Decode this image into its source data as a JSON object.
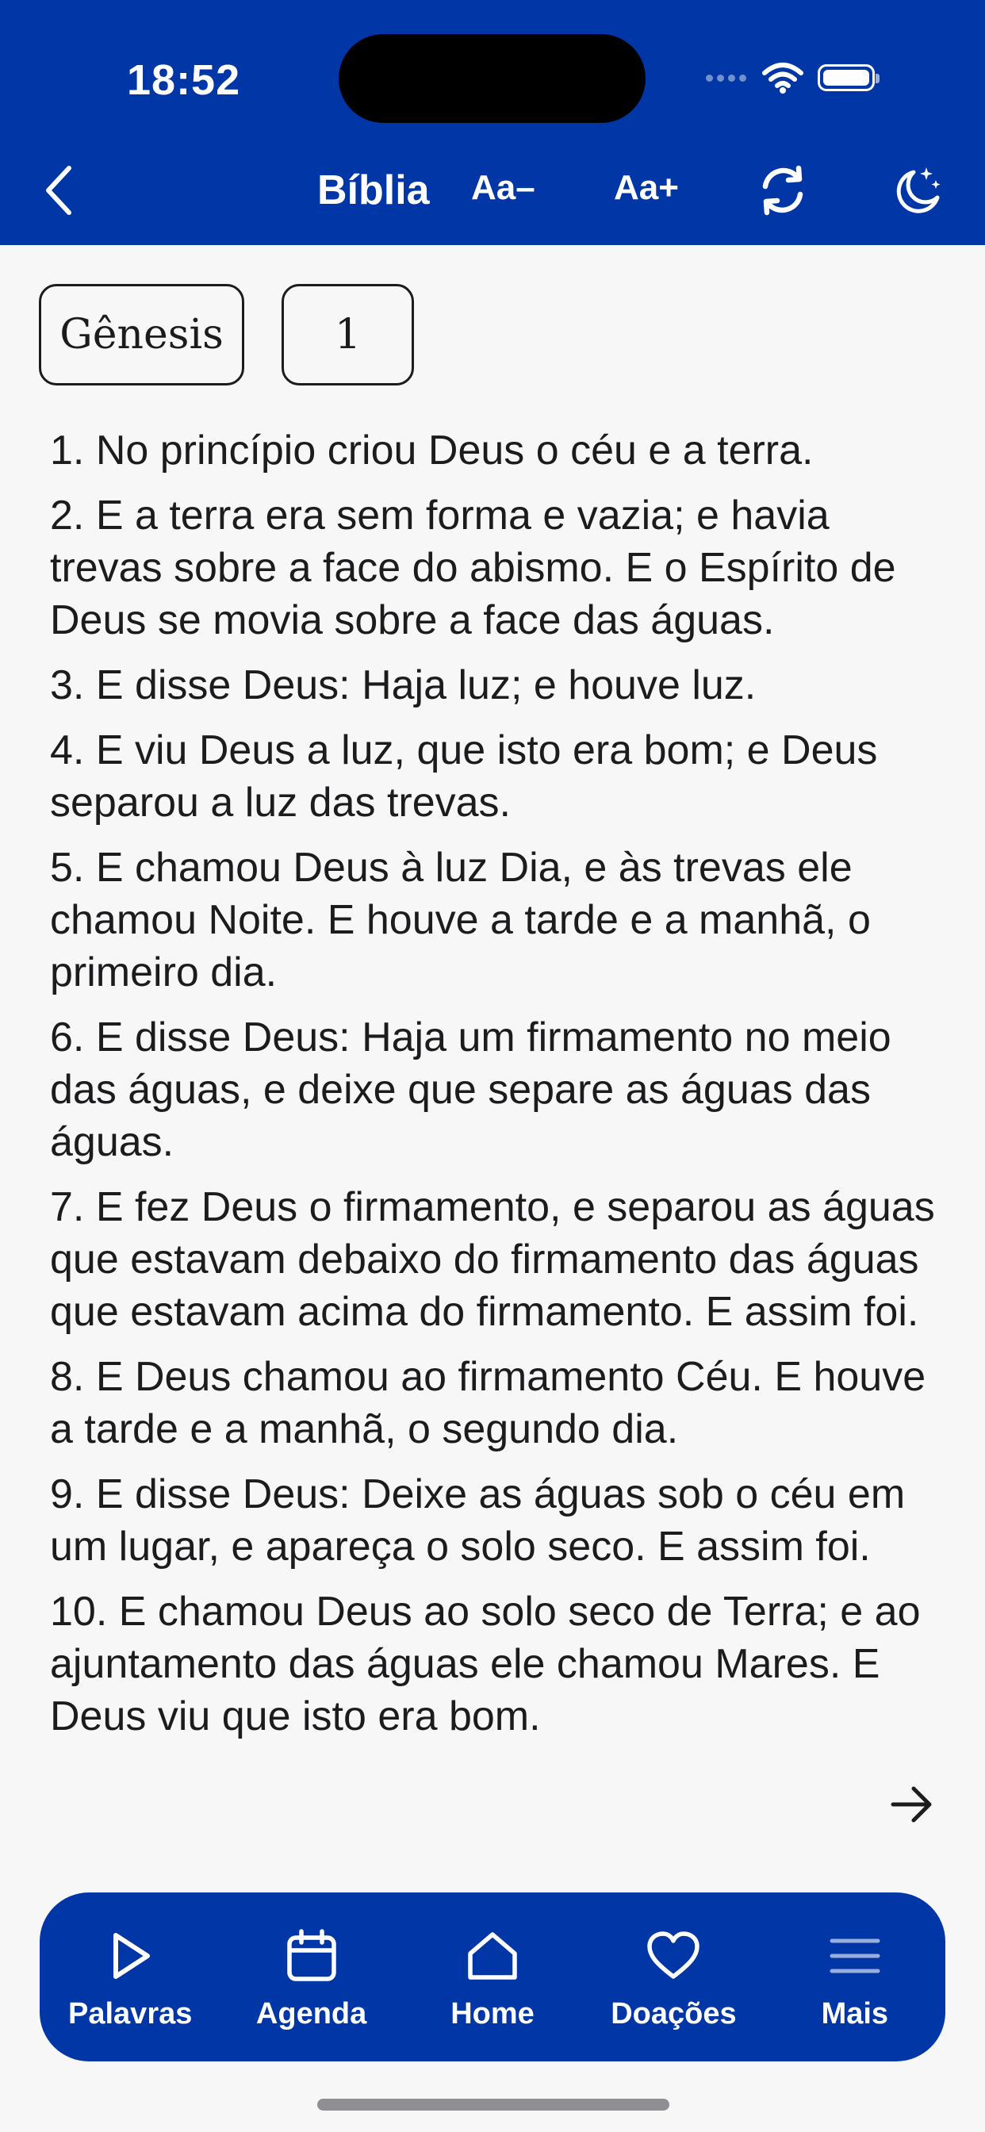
{
  "status_bar": {
    "time": "18:52"
  },
  "nav": {
    "title": "Bíblia",
    "font_decrease_label": "Aa–",
    "font_increase_label": "Aa+"
  },
  "selector": {
    "book": "Gênesis",
    "chapter": "1"
  },
  "verses": [
    "1. No princípio criou Deus o céu e a terra.",
    "2. E a terra era sem forma e vazia; e havia trevas sobre a face do abismo. E o Espírito de Deus se movia sobre a face das águas.",
    "3. E disse Deus: Haja luz; e houve luz.",
    "4. E viu Deus a luz, que isto era bom; e Deus separou a luz das trevas.",
    "5. E chamou Deus à luz Dia, e às trevas ele chamou Noite. E houve a tarde e a manhã, o primeiro dia.",
    "6. E disse Deus: Haja um firmamento no meio das águas, e deixe que separe as águas das águas.",
    "7. E fez Deus o firmamento, e separou as águas que estavam debaixo do firmamento das águas que estavam acima do firmamento. E assim foi.",
    "8. E Deus chamou ao firmamento Céu. E houve a tarde e a manhã, o segundo dia.",
    "9. E disse Deus: Deixe as águas sob o céu em um lugar, e apareça o solo seco. E assim foi.",
    "10. E chamou Deus ao solo seco de Terra; e ao ajuntamento das águas ele chamou Mares. E Deus viu que isto era bom."
  ],
  "tabs": [
    {
      "label": "Palavras",
      "icon": "play-icon"
    },
    {
      "label": "Agenda",
      "icon": "calendar-icon"
    },
    {
      "label": "Home",
      "icon": "home-icon"
    },
    {
      "label": "Doações",
      "icon": "heart-icon"
    },
    {
      "label": "Mais",
      "icon": "menu-icon"
    }
  ],
  "colors": {
    "brand_blue": "#0136a6",
    "background": "#f7f7f8",
    "text": "#1c1c1e"
  }
}
